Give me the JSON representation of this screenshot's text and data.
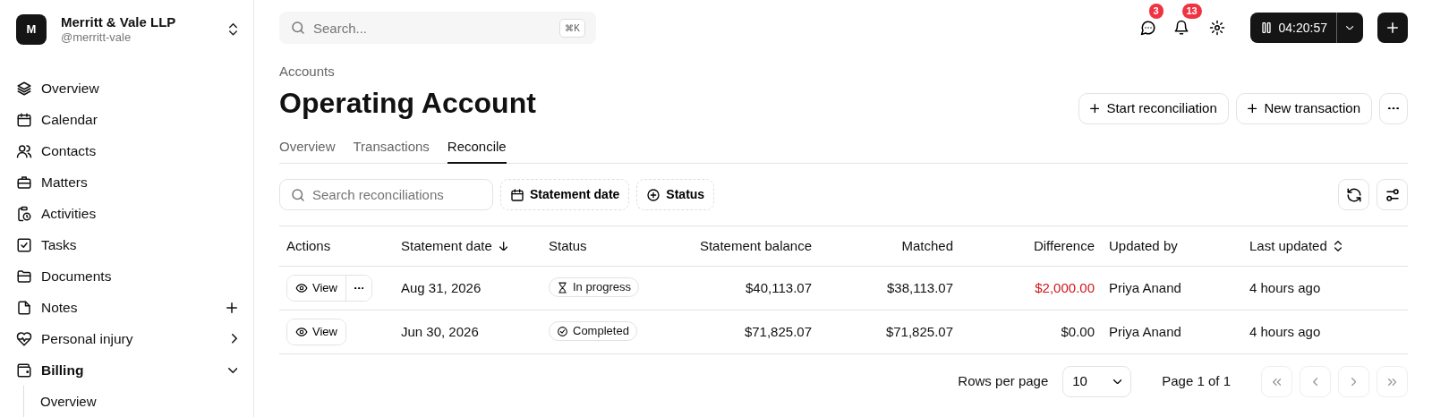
{
  "workspace": {
    "avatar": "M",
    "name": "Merritt & Vale LLP",
    "handle": "@merritt-vale"
  },
  "sidebar": {
    "items": [
      {
        "label": "Overview",
        "kind": "link"
      },
      {
        "label": "Calendar",
        "kind": "link"
      },
      {
        "label": "Contacts",
        "kind": "link"
      },
      {
        "label": "Matters",
        "kind": "link"
      },
      {
        "label": "Activities",
        "kind": "link"
      },
      {
        "label": "Tasks",
        "kind": "link"
      },
      {
        "label": "Documents",
        "kind": "link"
      },
      {
        "label": "Notes",
        "kind": "addable"
      },
      {
        "label": "Personal injury",
        "kind": "group",
        "expanded": false
      },
      {
        "label": "Billing",
        "kind": "group",
        "expanded": true,
        "children": [
          {
            "label": "Overview"
          }
        ]
      }
    ]
  },
  "search": {
    "placeholder": "Search...",
    "shortcut": "⌘K"
  },
  "notifications": [
    {
      "count": "3"
    },
    {
      "count": "13"
    }
  ],
  "timer": {
    "time": "04:20:57"
  },
  "breadcrumb": "Accounts",
  "title": "Operating Account",
  "actions": [
    "Start reconciliation",
    "New transaction"
  ],
  "tabs": [
    {
      "label": "Overview",
      "selected": false
    },
    {
      "label": "Transactions",
      "selected": false
    },
    {
      "label": "Reconcile",
      "selected": true
    }
  ],
  "filter_search": {
    "placeholder": "Search reconciliations"
  },
  "filters": [
    "Statement date",
    "Status"
  ],
  "table": {
    "columns": [
      "Actions",
      "Statement date",
      "Status",
      "Statement balance",
      "Matched",
      "Difference",
      "Updated by",
      "Last updated"
    ],
    "rows": [
      {
        "view": "View",
        "more": true,
        "date": "Aug 31, 2026",
        "status": "In progress",
        "completed": false,
        "balance": "$40,113.07",
        "matched": "$38,113.07",
        "difference": "$2,000.00",
        "difference_alert": true,
        "updated_by": "Priya Anand",
        "last_updated": "4 hours ago"
      },
      {
        "view": "View",
        "more": false,
        "date": "Jun 30, 2026",
        "status": "Completed",
        "completed": true,
        "balance": "$71,825.07",
        "matched": "$71,825.07",
        "difference": "$0.00",
        "difference_alert": false,
        "updated_by": "Priya Anand",
        "last_updated": "4 hours ago"
      }
    ]
  },
  "pagination": {
    "rows_label": "Rows per page",
    "rows_value": "10",
    "page": "Page 1 of 1",
    "buttons": [
      {
        "disabled": true
      },
      {
        "disabled": true
      },
      {
        "disabled": true
      },
      {
        "disabled": true
      }
    ]
  }
}
